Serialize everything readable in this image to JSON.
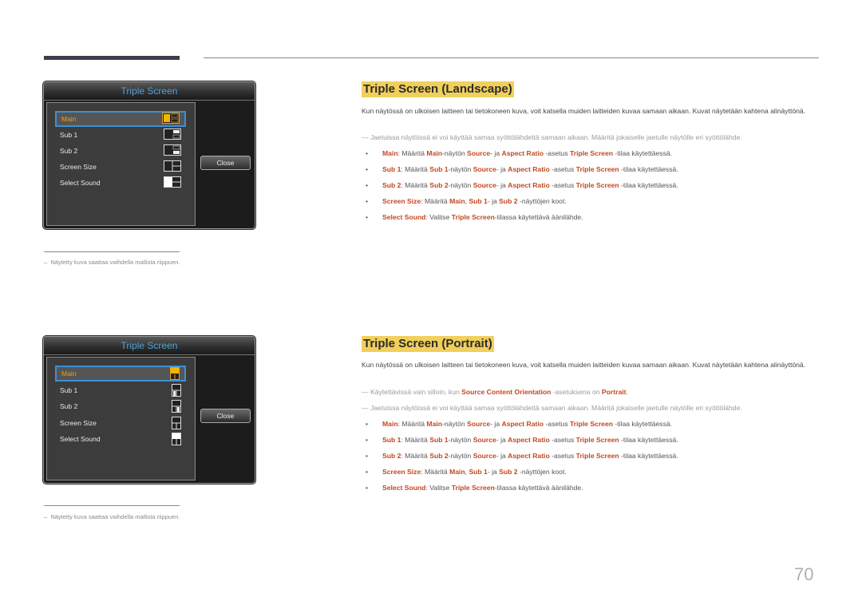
{
  "page": {
    "number": "70"
  },
  "osd_landscape": {
    "title": "Triple Screen",
    "items": [
      {
        "label": "Main",
        "selected": true,
        "icon": "layout-main-landscape-icon"
      },
      {
        "label": "Sub 1",
        "selected": false,
        "icon": "layout-sub1-landscape-icon"
      },
      {
        "label": "Sub 2",
        "selected": false,
        "icon": "layout-sub2-landscape-icon"
      },
      {
        "label": "Screen Size",
        "selected": false,
        "icon": "layout-screen-size-landscape-icon"
      },
      {
        "label": "Select Sound",
        "selected": false,
        "icon": "layout-select-sound-landscape-icon"
      }
    ],
    "close_label": "Close",
    "note": "Näytetty kuva saattaa vaihdella mallista riippuen.",
    "note_prefix": "–"
  },
  "osd_portrait": {
    "title": "Triple Screen",
    "items": [
      {
        "label": "Main",
        "selected": true,
        "icon": "layout-main-portrait-icon"
      },
      {
        "label": "Sub 1",
        "selected": false,
        "icon": "layout-sub1-portrait-icon"
      },
      {
        "label": "Sub 2",
        "selected": false,
        "icon": "layout-sub2-portrait-icon"
      },
      {
        "label": "Screen Size",
        "selected": false,
        "icon": "layout-screen-size-portrait-icon"
      },
      {
        "label": "Select Sound",
        "selected": false,
        "icon": "layout-select-sound-portrait-icon"
      }
    ],
    "close_label": "Close",
    "note": "Näytetty kuva saattaa vaihdella mallista riippuen.",
    "note_prefix": "–"
  },
  "landscape": {
    "heading": "Triple Screen (Landscape)",
    "intro": "Kun näytössä on ulkoisen laitteen tai tietokoneen kuva, voit katsella muiden laitteiden kuvaa samaan aikaan. Kuvat näytetään kahtena alinäyttönä.",
    "note_dash": "—",
    "note": "Jaetuissa näytöissä ei voi käyttää samaa syöttölähdettä samaan aikaan. Määritä jokaiselle jaetulle näytölle eri syöttölähde.",
    "bullets": [
      [
        {
          "t": "Main",
          "h": true
        },
        {
          "t": ": Määritä "
        },
        {
          "t": "Main",
          "h": true
        },
        {
          "t": "-näytön "
        },
        {
          "t": "Source",
          "h": true
        },
        {
          "t": "- ja "
        },
        {
          "t": "Aspect Ratio",
          "h": true
        },
        {
          "t": " -asetus "
        },
        {
          "t": "Triple Screen",
          "h": true
        },
        {
          "t": " -tilaa käytettäessä."
        }
      ],
      [
        {
          "t": "Sub 1",
          "h": true
        },
        {
          "t": ": Määritä "
        },
        {
          "t": "Sub 1",
          "h": true
        },
        {
          "t": "-näytön "
        },
        {
          "t": "Source",
          "h": true
        },
        {
          "t": "- ja "
        },
        {
          "t": "Aspect Ratio",
          "h": true
        },
        {
          "t": " -asetus "
        },
        {
          "t": "Triple Screen",
          "h": true
        },
        {
          "t": " -tilaa käytettäessä."
        }
      ],
      [
        {
          "t": "Sub 2",
          "h": true
        },
        {
          "t": ": Määritä "
        },
        {
          "t": "Sub 2",
          "h": true
        },
        {
          "t": "-näytön "
        },
        {
          "t": "Source",
          "h": true
        },
        {
          "t": "- ja "
        },
        {
          "t": "Aspect Ratio",
          "h": true
        },
        {
          "t": " -asetus "
        },
        {
          "t": "Triple Screen",
          "h": true
        },
        {
          "t": " -tilaa käytettäessä."
        }
      ],
      [
        {
          "t": "Screen Size",
          "h": true
        },
        {
          "t": ": Määritä "
        },
        {
          "t": "Main",
          "h": true
        },
        {
          "t": ", "
        },
        {
          "t": "Sub 1",
          "h": true
        },
        {
          "t": "- ja "
        },
        {
          "t": "Sub 2",
          "h": true
        },
        {
          "t": " -näyttöjen koot."
        }
      ],
      [
        {
          "t": "Select Sound",
          "h": true
        },
        {
          "t": ": Valitse "
        },
        {
          "t": "Triple Screen",
          "h": true
        },
        {
          "t": "-tilassa käytettävä äänilähde."
        }
      ]
    ]
  },
  "portrait": {
    "heading": "Triple Screen (Portrait)",
    "intro": "Kun näytössä on ulkoisen laitteen tai tietokoneen kuva, voit katsella muiden laitteiden kuvaa samaan aikaan. Kuvat näytetään kahtena alinäyttönä.",
    "note_dash": "—",
    "note1": [
      {
        "t": "Käytettävissä vain silloin, kun "
      },
      {
        "t": "Source Content Orientation",
        "h": true
      },
      {
        "t": " -asetuksena on "
      },
      {
        "t": "Portrait",
        "h": true
      },
      {
        "t": "."
      }
    ],
    "note2": "Jaetuissa näytöissä ei voi käyttää samaa syöttölähdettä samaan aikaan. Määritä jokaiselle jaetulle näytölle eri syöttölähde.",
    "bullets": [
      [
        {
          "t": "Main",
          "h": true
        },
        {
          "t": ": Määritä "
        },
        {
          "t": "Main",
          "h": true
        },
        {
          "t": "-näytön "
        },
        {
          "t": "Source",
          "h": true
        },
        {
          "t": "- ja "
        },
        {
          "t": "Aspect Ratio",
          "h": true
        },
        {
          "t": " -asetus "
        },
        {
          "t": "Triple Screen",
          "h": true
        },
        {
          "t": " -tilaa käytettäessä."
        }
      ],
      [
        {
          "t": "Sub 1",
          "h": true
        },
        {
          "t": ": Määritä "
        },
        {
          "t": "Sub 1",
          "h": true
        },
        {
          "t": "-näytön "
        },
        {
          "t": "Source",
          "h": true
        },
        {
          "t": "- ja "
        },
        {
          "t": "Aspect Ratio",
          "h": true
        },
        {
          "t": " -asetus "
        },
        {
          "t": "Triple Screen",
          "h": true
        },
        {
          "t": " -tilaa käytettäessä."
        }
      ],
      [
        {
          "t": "Sub 2",
          "h": true
        },
        {
          "t": ": Määritä "
        },
        {
          "t": "Sub 2",
          "h": true
        },
        {
          "t": "-näytön "
        },
        {
          "t": "Source",
          "h": true
        },
        {
          "t": "- ja "
        },
        {
          "t": "Aspect Ratio",
          "h": true
        },
        {
          "t": " -asetus "
        },
        {
          "t": "Triple Screen",
          "h": true
        },
        {
          "t": " -tilaa käytettäessä."
        }
      ],
      [
        {
          "t": "Screen Size",
          "h": true
        },
        {
          "t": ": Määritä "
        },
        {
          "t": "Main",
          "h": true
        },
        {
          "t": ", "
        },
        {
          "t": "Sub 1",
          "h": true
        },
        {
          "t": "- ja "
        },
        {
          "t": "Sub 2",
          "h": true
        },
        {
          "t": " -näyttöjen koot."
        }
      ],
      [
        {
          "t": "Select Sound",
          "h": true
        },
        {
          "t": ": Valitse "
        },
        {
          "t": "Triple Screen",
          "h": true
        },
        {
          "t": "-tilassa käytettävä äänilähde."
        }
      ]
    ]
  },
  "colors": {
    "highlight_text": "#c4471f",
    "heading_bg": "#f1cf5b",
    "osd_title": "#4fa3d9",
    "selected_text": "#e8a317",
    "selection_border": "#3d8fd6"
  }
}
